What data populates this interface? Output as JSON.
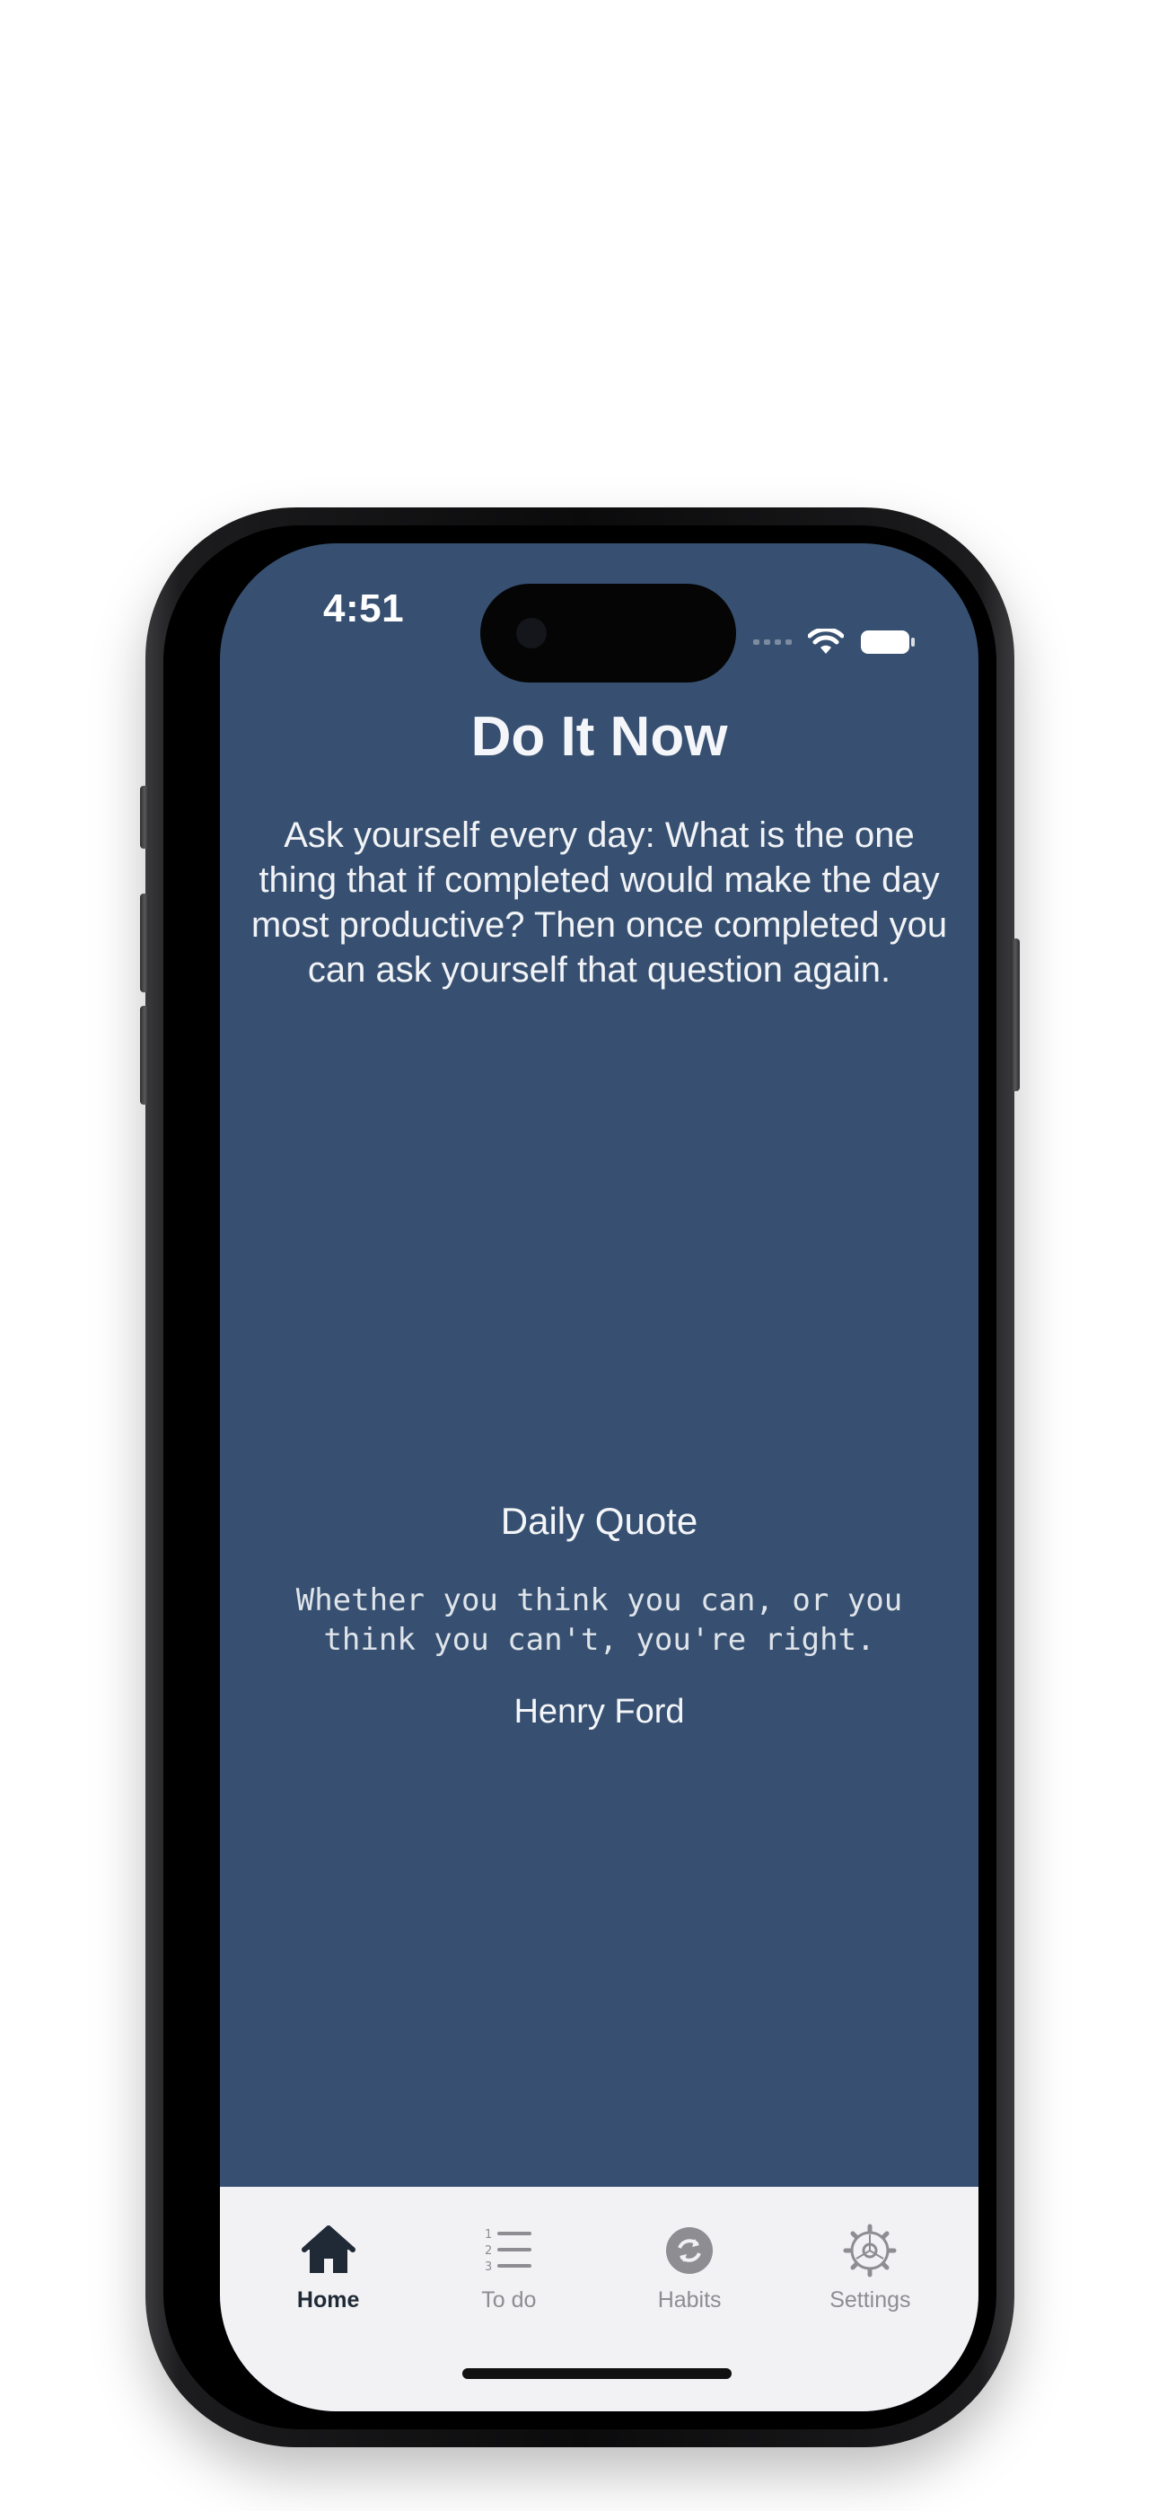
{
  "status_bar": {
    "time": "4:51"
  },
  "header": {
    "title": "Do It Now"
  },
  "prompt": {
    "text": "Ask yourself every day: What is the one thing that if completed would make the day most productive? Then once completed you can ask yourself that question again."
  },
  "daily_quote": {
    "heading": "Daily Quote",
    "quote": "Whether you think you can, or you think you can't, you're right.",
    "author": "Henry Ford"
  },
  "tab_bar": {
    "tabs": [
      {
        "label": "Home",
        "icon": "home-icon",
        "active": true
      },
      {
        "label": "To do",
        "icon": "numbered-list-icon",
        "active": false
      },
      {
        "label": "Habits",
        "icon": "repeat-icon",
        "active": false
      },
      {
        "label": "Settings",
        "icon": "gear-icon",
        "active": false
      }
    ]
  },
  "colors": {
    "background": "#375071",
    "tab_bar": "#f2f2f4",
    "active_tab": "#1f2a36",
    "inactive_tab": "#8d8d92"
  }
}
